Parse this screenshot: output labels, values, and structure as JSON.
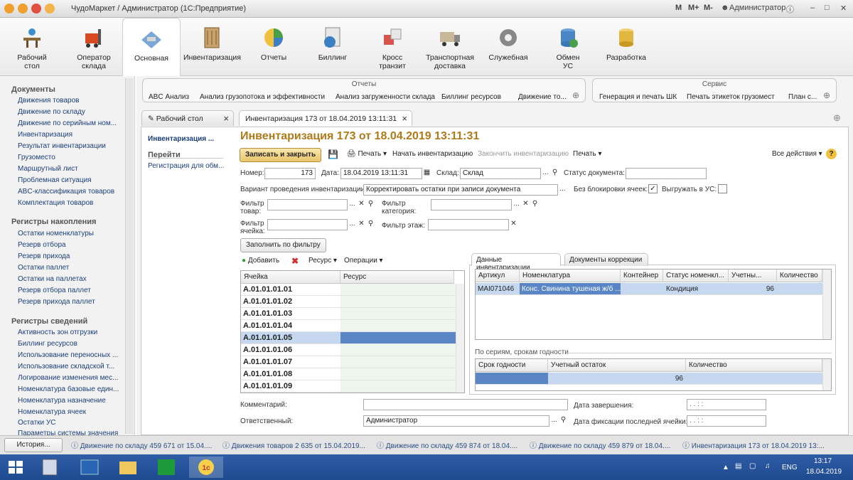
{
  "window": {
    "title": "ЧудоМаркет / Администратор  (1С:Предприятие)",
    "mem": [
      "M",
      "M+",
      "M-"
    ],
    "user": "Администратор"
  },
  "sections": [
    {
      "label": "Рабочий\nстол"
    },
    {
      "label": "Оператор\nсклада"
    },
    {
      "label": "Основная"
    },
    {
      "label": "Инвентаризация"
    },
    {
      "label": "Отчеты"
    },
    {
      "label": "Биллинг"
    },
    {
      "label": "Кросс\nтранзит"
    },
    {
      "label": "Транспортная\nдоставка"
    },
    {
      "label": "Служебная"
    },
    {
      "label": "Обмен\nУС"
    },
    {
      "label": "Разработка"
    }
  ],
  "nav": {
    "groups": [
      {
        "title": "Документы",
        "items": [
          "Движения товаров",
          "Движение по складу",
          "Движение по серийным ном...",
          "Инвентаризация",
          "Результат инвентаризации",
          "Грузоместо",
          "Маршрутный лист",
          "Проблемная ситуация",
          "ABC-классификация товаров",
          "Комплектация товаров"
        ]
      },
      {
        "title": "Регистры накопления",
        "items": [
          "Остатки номенклатуры",
          "Резерв отбора",
          "Резерв прихода",
          "Остатки паллет",
          "Остатки на паллетах",
          "Резерв отбора паллет",
          "Резерв прихода паллет"
        ]
      },
      {
        "title": "Регистры сведений",
        "items": [
          "Активность зон отгрузки",
          "Биллинг ресурсов",
          "Использование переносных ...",
          "Использование складской т...",
          "Логирование изменения мес...",
          "Номенклатура базовые един...",
          "Номенклатура назначение",
          "Номенклатура ячеек",
          "Остатки УС",
          "Параметры системы значения"
        ]
      }
    ]
  },
  "panels": {
    "reports": {
      "title": "Отчеты",
      "items": [
        "ABC Анализ",
        "Анализ грузопотока и эффективности",
        "Анализ загруженности склада",
        "Биллинг ресурсов",
        "Движение то..."
      ]
    },
    "service": {
      "title": "Сервис",
      "items": [
        "Генерация и печать ШК",
        "Печать этикеток грузомест",
        "План с..."
      ]
    }
  },
  "tabs": [
    {
      "label": "Рабочий стол",
      "close": "×"
    },
    {
      "label": "Инвентаризация 173 от 18.04.2019 13:11:31",
      "close": "×"
    }
  ],
  "formnav": {
    "current": "Инвентаризация ...",
    "goto": "Перейти",
    "link": "Регистрация для обм..."
  },
  "form": {
    "title": "Инвентаризация 173 от 18.04.2019 13:11:31",
    "toolbar": {
      "save_close": "Записать и закрыть",
      "print": "Печать",
      "start": "Начать инвентаризацию",
      "finish": "Закончить инвентаризацию",
      "print2": "Печать",
      "all_actions": "Все действия",
      "help": "?"
    },
    "number_label": "Номер:",
    "number": "173",
    "date_label": "Дата:",
    "date": "18.04.2019 13:11:31",
    "warehouse_label": "Склад:",
    "warehouse": "Склад",
    "status_label": "Статус документа:",
    "status": "",
    "variant_label": "Вариант проведения инвентаризации:",
    "variant": "Корректировать остатки при записи документа",
    "noblock_label": "Без блокировки ячеек:",
    "noblock_checked": true,
    "export_label": "Выгружать в УС:",
    "export_checked": false,
    "filter_goods_label": "Фильтр\nтовар:",
    "filter_cat_label": "Фильтр\nкатегория:",
    "filter_cell_label": "Фильтр\nячейка:",
    "filter_floor_label": "Фильтр этаж:",
    "fill_button": "Заполнить по фильтру",
    "cells_toolbar": {
      "add": "Добавить",
      "resource": "Ресурс",
      "ops": "Операции"
    },
    "cells_columns": [
      "Ячейка",
      "Ресурс"
    ],
    "cells": [
      "A.01.01.01.01",
      "A.01.01.01.02",
      "A.01.01.01.03",
      "A.01.01.01.04",
      "A.01.01.01.05",
      "A.01.01.01.06",
      "A.01.01.01.07",
      "A.01.01.01.08",
      "A.01.01.01.09"
    ],
    "selected_cell": "A.01.01.01.05",
    "right_tabs": [
      "Данные инвентаризации",
      "Документы коррекции"
    ],
    "inv_columns": [
      "Артикул",
      "Номенклатура",
      "Контейнер",
      "Статус номенкл...",
      "Учетны...",
      "Количество"
    ],
    "inv_rows": [
      {
        "art": "MAI071046",
        "name": "Конс. Свинина тушеная ж/б ...",
        "cont": "",
        "status": "Кондиция",
        "acc": "96",
        "qty": ""
      }
    ],
    "series_title": "По сериям, срокам годности",
    "series_columns": [
      "Срок годности",
      "Учетный остаток",
      "Количество"
    ],
    "series_rows": [
      {
        "exp": "",
        "acc": "96",
        "qty": ""
      }
    ],
    "comment_label": "Комментарий:",
    "comment": "",
    "responsible_label": "Ответственный:",
    "responsible": "Администратор",
    "end_date_label": "Дата завершения:",
    "end_date": ".  .    :  :",
    "fix_date_label": "Дата фиксации последней ячейки:",
    "fix_date": ".  .    :  :"
  },
  "history": {
    "button": "История...",
    "items": [
      "Движение по складу 459 671 от 15.04....",
      "Движения товаров 2 635 от 15.04.2019...",
      "Движение по складу 459 874 от 18.04....",
      "Движение по складу 459 879 от 18.04....",
      "Инвентаризация 173 от 18.04.2019 13:..."
    ]
  },
  "taskbar": {
    "lang": "ENG",
    "time": "13:17",
    "date": "18.04.2019"
  },
  "colors": {
    "accent_title": "#b07a1a",
    "selection": "#c5d8f0",
    "selected_dark": "#5b86c5",
    "taskbar": "#2a5599"
  }
}
